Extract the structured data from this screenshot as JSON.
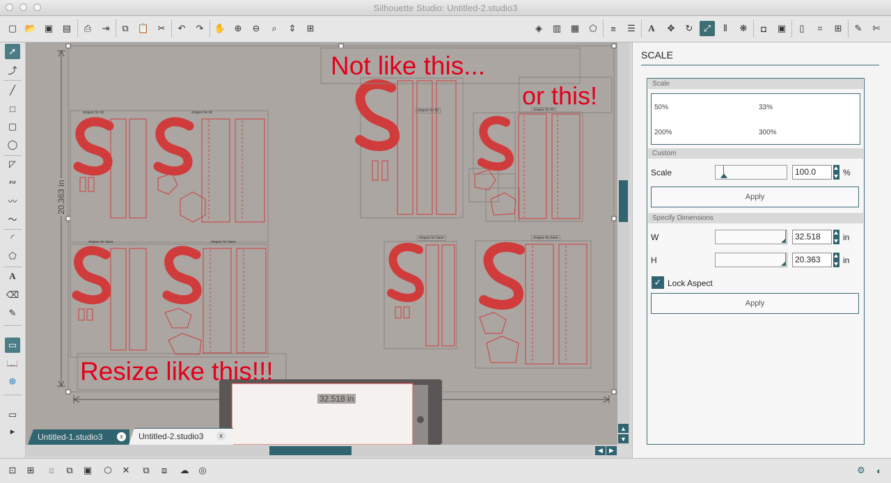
{
  "window": {
    "title": "Silhouette Studio: Untitled-2.studio3"
  },
  "canvas": {
    "annotations": {
      "not_like_this": "Not like this...",
      "or_this": "or this!",
      "resize_like_this": "Resize like this!!!"
    },
    "dimensions": {
      "height": "20.363 in",
      "width": "32.518 in"
    },
    "design_labels": {
      "shapes_for_lid": "shapes for lid",
      "shapes_for_base": "shapes for base"
    }
  },
  "tabs": [
    {
      "label": "Untitled-1.studio3",
      "active": false
    },
    {
      "label": "Untitled-2.studio3",
      "active": true
    }
  ],
  "panel": {
    "title": "SCALE",
    "scale_section": {
      "header": "Scale",
      "presets": [
        "50%",
        "33%",
        "200%",
        "300%"
      ]
    },
    "custom_section": {
      "header": "Custom",
      "scale_label": "Scale",
      "scale_value": "100.0",
      "scale_unit": "%",
      "apply_label": "Apply"
    },
    "dimensions_section": {
      "header": "Specify Dimensions",
      "w_label": "W",
      "w_value": "32.518",
      "h_label": "H",
      "h_value": "20.363",
      "unit": "in",
      "lock_aspect_label": "Lock Aspect",
      "lock_aspect_checked": true,
      "apply_label": "Apply"
    }
  },
  "colors": {
    "accent": "#2f6470",
    "cut_line": "#d03c3c",
    "annotation": "#e3001b",
    "canvas": "#aba6a2"
  }
}
